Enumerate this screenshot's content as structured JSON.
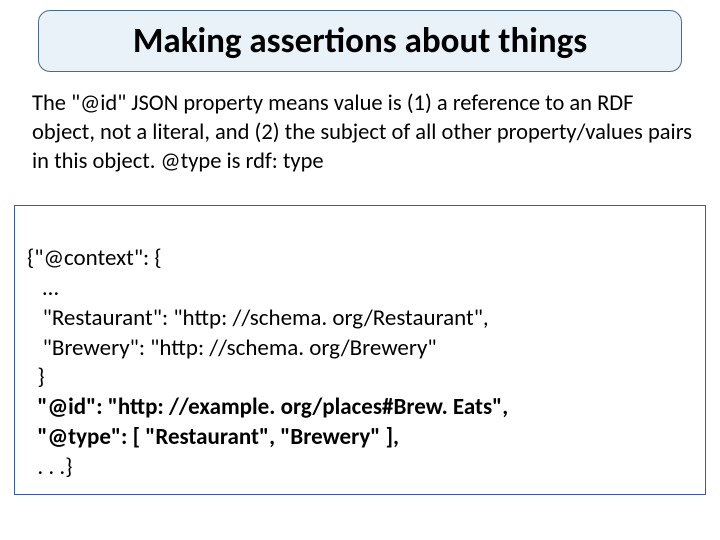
{
  "title": "Making assertions about things",
  "description": "The \"@id\" JSON property means value is (1) a reference to an RDF object, not a literal, and (2) the subject of all other property/values pairs in this object. @type is rdf: type",
  "code": {
    "l1": "{\"@context\": {",
    "l2": "   …",
    "l3": "   \"Restaurant\": \"http: //schema. org/Restaurant\",",
    "l4": "   \"Brewery\": \"http: //schema. org/Brewery\"",
    "l5": "  }",
    "l6_a": "  \"@id\": \"http: //example. org/places#Brew. Eats\",",
    "l7_a": "  \"@type\": [ \"Restaurant\", \"Brewery\" ],",
    "l8": "  . . .}"
  }
}
